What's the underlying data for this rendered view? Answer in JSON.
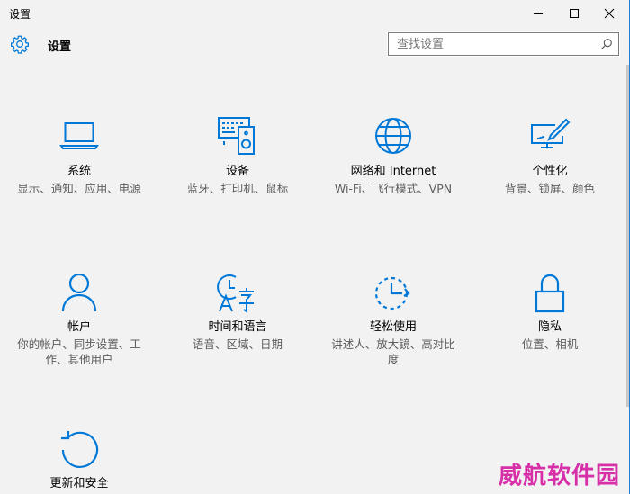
{
  "window": {
    "title": "设置"
  },
  "header": {
    "title": "设置"
  },
  "search": {
    "placeholder": "查找设置",
    "value": ""
  },
  "tiles": [
    {
      "name": "系统",
      "desc": "显示、通知、应用、电源",
      "icon": "laptop-icon"
    },
    {
      "name": "设备",
      "desc": "蓝牙、打印机、鼠标",
      "icon": "devices-icon"
    },
    {
      "name": "网络和 Internet",
      "desc": "Wi-Fi、飞行模式、VPN",
      "icon": "globe-icon"
    },
    {
      "name": "个性化",
      "desc": "背景、锁屏、颜色",
      "icon": "personalization-icon"
    },
    {
      "name": "帐户",
      "desc": "你的帐户、同步设置、工作、其他用户",
      "icon": "person-icon"
    },
    {
      "name": "时间和语言",
      "desc": "语音、区域、日期",
      "icon": "time-language-icon"
    },
    {
      "name": "轻松使用",
      "desc": "讲述人、放大镜、高对比度",
      "icon": "ease-of-access-icon"
    },
    {
      "name": "隐私",
      "desc": "位置、相机",
      "icon": "lock-icon"
    },
    {
      "name": "更新和安全",
      "desc": "",
      "icon": "update-icon"
    }
  ],
  "watermark": "威航软件园",
  "colors": {
    "accent": "#0078d7",
    "watermark": "#d62fa8"
  }
}
